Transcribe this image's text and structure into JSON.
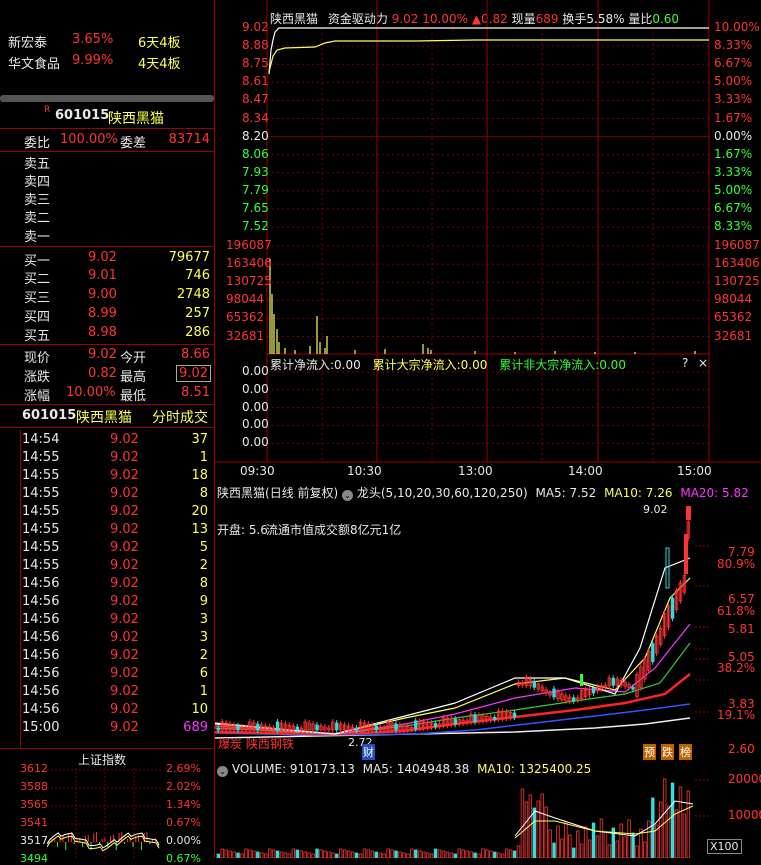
{
  "watch_list": [
    {
      "name": "新宏泰",
      "pct": "3.65%",
      "boards": "6天4板"
    },
    {
      "name": "华文食品",
      "pct": "9.99%",
      "boards": "4天4板"
    }
  ],
  "quote": {
    "flag": "R",
    "code": "601015",
    "name": "陕西黑猫",
    "weibi_label": "委比",
    "weibi_value": "100.00%",
    "weicha_label": "委差",
    "weicha_value": "83714",
    "sell": [
      {
        "label": "卖五",
        "price": "",
        "vol": ""
      },
      {
        "label": "卖四",
        "price": "",
        "vol": ""
      },
      {
        "label": "卖三",
        "price": "",
        "vol": ""
      },
      {
        "label": "卖二",
        "price": "",
        "vol": ""
      },
      {
        "label": "卖一",
        "price": "",
        "vol": ""
      }
    ],
    "buy": [
      {
        "label": "买一",
        "price": "9.02",
        "vol": "79677"
      },
      {
        "label": "买二",
        "price": "9.01",
        "vol": "746"
      },
      {
        "label": "买三",
        "price": "9.00",
        "vol": "2748"
      },
      {
        "label": "买四",
        "price": "8.99",
        "vol": "257"
      },
      {
        "label": "买五",
        "price": "8.98",
        "vol": "286"
      }
    ],
    "stats": [
      {
        "l1": "现价",
        "v1": "9.02",
        "l2": "今开",
        "v2": "8.66"
      },
      {
        "l1": "涨跌",
        "v1": "0.82",
        "l2": "最高",
        "v2": "9.02"
      },
      {
        "l1": "涨幅",
        "v1": "10.00%",
        "l2": "最低",
        "v2": "8.51"
      }
    ]
  },
  "ticks": {
    "header_code": "601015",
    "header_name": "陕西黑猫",
    "header_title": "分时成交",
    "rows": [
      {
        "time": "14:54",
        "price": "9.02",
        "vol": "37"
      },
      {
        "time": "14:55",
        "price": "9.02",
        "vol": "1"
      },
      {
        "time": "14:55",
        "price": "9.02",
        "vol": "18"
      },
      {
        "time": "14:55",
        "price": "9.02",
        "vol": "8"
      },
      {
        "time": "14:55",
        "price": "9.02",
        "vol": "20"
      },
      {
        "time": "14:55",
        "price": "9.02",
        "vol": "13"
      },
      {
        "time": "14:55",
        "price": "9.02",
        "vol": "5"
      },
      {
        "time": "14:55",
        "price": "9.02",
        "vol": "2"
      },
      {
        "time": "14:56",
        "price": "9.02",
        "vol": "8"
      },
      {
        "time": "14:56",
        "price": "9.02",
        "vol": "9"
      },
      {
        "time": "14:56",
        "price": "9.02",
        "vol": "3"
      },
      {
        "time": "14:56",
        "price": "9.02",
        "vol": "3"
      },
      {
        "time": "14:56",
        "price": "9.02",
        "vol": "2"
      },
      {
        "time": "14:56",
        "price": "9.02",
        "vol": "6"
      },
      {
        "time": "14:56",
        "price": "9.02",
        "vol": "1"
      },
      {
        "time": "14:56",
        "price": "9.02",
        "vol": "10"
      },
      {
        "time": "15:00",
        "price": "9.02",
        "vol": "689"
      }
    ]
  },
  "mini_index": {
    "title": "上证指数",
    "left_ticks": [
      "3612",
      "3588",
      "3565",
      "3541",
      "3517",
      "3494"
    ],
    "right_ticks": [
      "2.69%",
      "2.02%",
      "1.34%",
      "0.67%",
      "0.00%",
      "0.67%"
    ]
  },
  "intraday": {
    "name": "陕西黑猫",
    "indicator": "资金驱动力",
    "price": "9.02",
    "pct": "10.00%",
    "change": "▲0.82",
    "vol_label": "现量",
    "vol": "689",
    "turnover_label": "换手",
    "turnover": "5.58%",
    "ratio_label": "量比",
    "ratio": "0.60",
    "price_ticks": [
      "9.02",
      "8.88",
      "8.75",
      "8.61",
      "8.47",
      "8.34",
      "8.20",
      "8.06",
      "7.93",
      "7.79",
      "7.65",
      "7.52"
    ],
    "pct_ticks": [
      "10.00%",
      "8.33%",
      "6.67%",
      "5.00%",
      "3.33%",
      "1.67%",
      "0.00%",
      "1.67%",
      "3.33%",
      "5.00%",
      "6.67%",
      "8.33%"
    ],
    "vol_ticks": [
      "196087",
      "163406",
      "130725",
      "98044",
      "65362",
      "32681"
    ],
    "flow_header": {
      "a": "累计净流入:0.00",
      "b": "累计大宗净流入:0.00",
      "c": "累计非大宗净流入:0.00",
      "q": "?",
      "x": "×"
    },
    "flow_ticks": [
      "0.00",
      "0.00",
      "0.00",
      "0.00",
      "0.00"
    ],
    "time_ticks": [
      "09:30",
      "10:30",
      "13:00",
      "14:00",
      "15:00"
    ]
  },
  "daily": {
    "name": "陕西黑猫",
    "mode": "(日线 前复权)",
    "indicator": "龙头",
    "params": "(5,10,20,30,60,120,250)",
    "ma5": "MA5: 7.52",
    "ma10": "MA10: 7.26",
    "ma20": "MA20: 5.82",
    "note": "开盘: 5.6",
    "note2": "流通市值成交额8亿元1亿",
    "high_label": "9.02",
    "low_label": "2.72",
    "bottom_label": "爆炭 陕西钢铁",
    "cai": "财",
    "badges": [
      "预",
      "跌",
      "榜"
    ],
    "right_ticks": [
      "7.79",
      "80.9%",
      "6.57",
      "61.8%",
      "5.81",
      "5.05",
      "38.2%",
      "3.83",
      "19.1%",
      "2.60"
    ]
  },
  "volume_panel": {
    "label": "VOLUME: 910173.13",
    "ma5": "MA5: 1404948.38",
    "ma10": "MA10: 1325400.25",
    "ticks": [
      "20000",
      "10000"
    ],
    "unit": "X100"
  },
  "colors": {
    "up": "#ff3333",
    "down": "#33ff33",
    "grid": "#9a0000",
    "label": "#ffff55"
  }
}
